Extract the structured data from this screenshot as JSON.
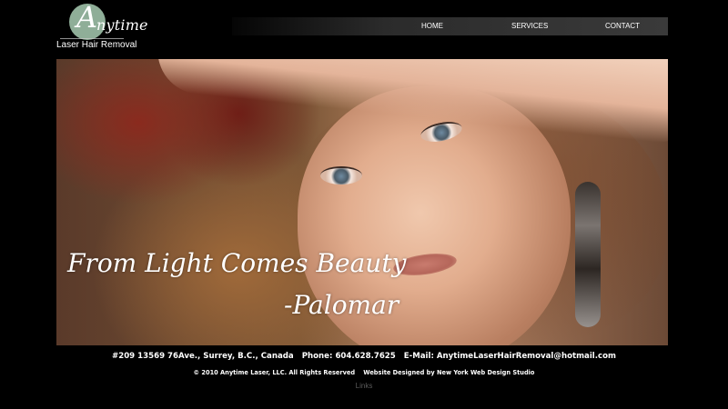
{
  "logo": {
    "initial": "A",
    "script_text": "nytime",
    "subtitle": "Laser Hair Removal"
  },
  "nav": {
    "items": [
      {
        "label": "HOME"
      },
      {
        "label": "SERVICES"
      },
      {
        "label": "CONTACT"
      }
    ]
  },
  "hero": {
    "quote": "From Light Comes Beauty",
    "author": "-Palomar"
  },
  "footer": {
    "address": "#209 13569 76Ave., Surrey, B.C., Canada",
    "phone_label": "Phone:",
    "phone": "604.628.7625",
    "email_label": "E-Mail:",
    "email": "AnytimeLaserHairRemoval@hotmail.com",
    "copyright": "© 2010 Anytime Laser, LLC. All Rights Reserved",
    "designer_label": "Website Designed by New York Web Design Studio",
    "links_label": "Links"
  },
  "colors": {
    "background": "#000000",
    "logo_circle": "#8fae98",
    "nav_bar": "#3a3a3a",
    "links_text": "#5a5a5a"
  }
}
